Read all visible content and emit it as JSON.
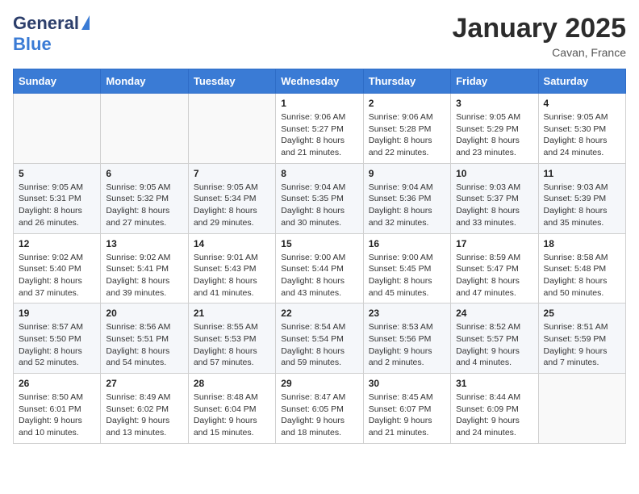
{
  "logo": {
    "general": "General",
    "blue": "Blue"
  },
  "header": {
    "month": "January 2025",
    "location": "Cavan, France"
  },
  "weekdays": [
    "Sunday",
    "Monday",
    "Tuesday",
    "Wednesday",
    "Thursday",
    "Friday",
    "Saturday"
  ],
  "weeks": [
    [
      {
        "day": "",
        "content": ""
      },
      {
        "day": "",
        "content": ""
      },
      {
        "day": "",
        "content": ""
      },
      {
        "day": "1",
        "content": "Sunrise: 9:06 AM\nSunset: 5:27 PM\nDaylight: 8 hours and 21 minutes."
      },
      {
        "day": "2",
        "content": "Sunrise: 9:06 AM\nSunset: 5:28 PM\nDaylight: 8 hours and 22 minutes."
      },
      {
        "day": "3",
        "content": "Sunrise: 9:05 AM\nSunset: 5:29 PM\nDaylight: 8 hours and 23 minutes."
      },
      {
        "day": "4",
        "content": "Sunrise: 9:05 AM\nSunset: 5:30 PM\nDaylight: 8 hours and 24 minutes."
      }
    ],
    [
      {
        "day": "5",
        "content": "Sunrise: 9:05 AM\nSunset: 5:31 PM\nDaylight: 8 hours and 26 minutes."
      },
      {
        "day": "6",
        "content": "Sunrise: 9:05 AM\nSunset: 5:32 PM\nDaylight: 8 hours and 27 minutes."
      },
      {
        "day": "7",
        "content": "Sunrise: 9:05 AM\nSunset: 5:34 PM\nDaylight: 8 hours and 29 minutes."
      },
      {
        "day": "8",
        "content": "Sunrise: 9:04 AM\nSunset: 5:35 PM\nDaylight: 8 hours and 30 minutes."
      },
      {
        "day": "9",
        "content": "Sunrise: 9:04 AM\nSunset: 5:36 PM\nDaylight: 8 hours and 32 minutes."
      },
      {
        "day": "10",
        "content": "Sunrise: 9:03 AM\nSunset: 5:37 PM\nDaylight: 8 hours and 33 minutes."
      },
      {
        "day": "11",
        "content": "Sunrise: 9:03 AM\nSunset: 5:39 PM\nDaylight: 8 hours and 35 minutes."
      }
    ],
    [
      {
        "day": "12",
        "content": "Sunrise: 9:02 AM\nSunset: 5:40 PM\nDaylight: 8 hours and 37 minutes."
      },
      {
        "day": "13",
        "content": "Sunrise: 9:02 AM\nSunset: 5:41 PM\nDaylight: 8 hours and 39 minutes."
      },
      {
        "day": "14",
        "content": "Sunrise: 9:01 AM\nSunset: 5:43 PM\nDaylight: 8 hours and 41 minutes."
      },
      {
        "day": "15",
        "content": "Sunrise: 9:00 AM\nSunset: 5:44 PM\nDaylight: 8 hours and 43 minutes."
      },
      {
        "day": "16",
        "content": "Sunrise: 9:00 AM\nSunset: 5:45 PM\nDaylight: 8 hours and 45 minutes."
      },
      {
        "day": "17",
        "content": "Sunrise: 8:59 AM\nSunset: 5:47 PM\nDaylight: 8 hours and 47 minutes."
      },
      {
        "day": "18",
        "content": "Sunrise: 8:58 AM\nSunset: 5:48 PM\nDaylight: 8 hours and 50 minutes."
      }
    ],
    [
      {
        "day": "19",
        "content": "Sunrise: 8:57 AM\nSunset: 5:50 PM\nDaylight: 8 hours and 52 minutes."
      },
      {
        "day": "20",
        "content": "Sunrise: 8:56 AM\nSunset: 5:51 PM\nDaylight: 8 hours and 54 minutes."
      },
      {
        "day": "21",
        "content": "Sunrise: 8:55 AM\nSunset: 5:53 PM\nDaylight: 8 hours and 57 minutes."
      },
      {
        "day": "22",
        "content": "Sunrise: 8:54 AM\nSunset: 5:54 PM\nDaylight: 8 hours and 59 minutes."
      },
      {
        "day": "23",
        "content": "Sunrise: 8:53 AM\nSunset: 5:56 PM\nDaylight: 9 hours and 2 minutes."
      },
      {
        "day": "24",
        "content": "Sunrise: 8:52 AM\nSunset: 5:57 PM\nDaylight: 9 hours and 4 minutes."
      },
      {
        "day": "25",
        "content": "Sunrise: 8:51 AM\nSunset: 5:59 PM\nDaylight: 9 hours and 7 minutes."
      }
    ],
    [
      {
        "day": "26",
        "content": "Sunrise: 8:50 AM\nSunset: 6:01 PM\nDaylight: 9 hours and 10 minutes."
      },
      {
        "day": "27",
        "content": "Sunrise: 8:49 AM\nSunset: 6:02 PM\nDaylight: 9 hours and 13 minutes."
      },
      {
        "day": "28",
        "content": "Sunrise: 8:48 AM\nSunset: 6:04 PM\nDaylight: 9 hours and 15 minutes."
      },
      {
        "day": "29",
        "content": "Sunrise: 8:47 AM\nSunset: 6:05 PM\nDaylight: 9 hours and 18 minutes."
      },
      {
        "day": "30",
        "content": "Sunrise: 8:45 AM\nSunset: 6:07 PM\nDaylight: 9 hours and 21 minutes."
      },
      {
        "day": "31",
        "content": "Sunrise: 8:44 AM\nSunset: 6:09 PM\nDaylight: 9 hours and 24 minutes."
      },
      {
        "day": "",
        "content": ""
      }
    ]
  ]
}
